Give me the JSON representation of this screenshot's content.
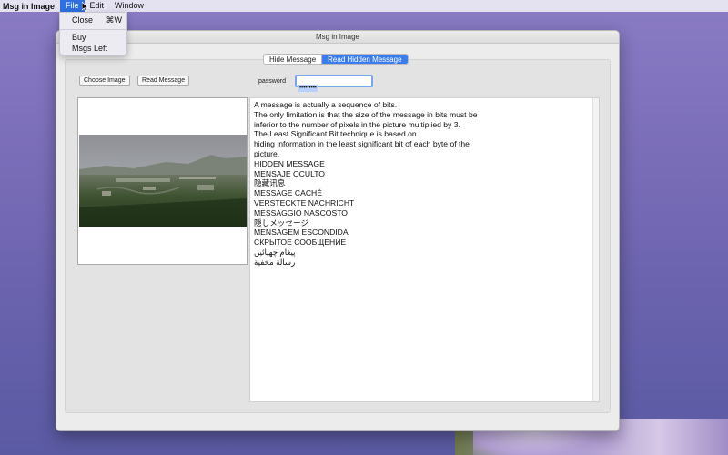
{
  "menubar": {
    "app_name": "Msg in Image",
    "menus": [
      "File",
      "Edit",
      "Window"
    ]
  },
  "file_menu": {
    "close_label": "Close",
    "close_shortcut": "⌘W",
    "buy_label": "Buy",
    "msgs_left_label": "Msgs Left"
  },
  "window": {
    "title": "Msg in Image"
  },
  "tabs": [
    {
      "label": "Hide Message",
      "selected": false
    },
    {
      "label": "Read Hidden Message",
      "selected": true
    }
  ],
  "buttons": {
    "choose_image": "Choose Image",
    "read_message": "Read Message"
  },
  "password": {
    "label": "password",
    "value": "•••••••••"
  },
  "message": {
    "lines": [
      "A message is actually a sequence of bits.",
      "The only limitation is that the size of the message in bits must be",
      "inferior to the number of pixels in the picture multiplied by 3.",
      "The Least Significant Bit technique is based on",
      "hiding information in the least significant bit of each byte of the",
      "picture.",
      "HIDDEN MESSAGE",
      "MENSAJE OCULTO",
      "隐藏讯息",
      "MESSAGE CACHÉ",
      "VERSTECKTE NACHRICHT",
      "MESSAGGIO NASCOSTO",
      "隠しメッセージ",
      "MENSAGEM ESCONDIDA",
      "СКРЫТОЕ СООБЩЕНИЕ",
      "پیغام چھپائیں",
      "رسالة مخفية"
    ]
  },
  "colors": {
    "accent": "#3a7df2",
    "menu_highlight": "#2f6fe0"
  }
}
